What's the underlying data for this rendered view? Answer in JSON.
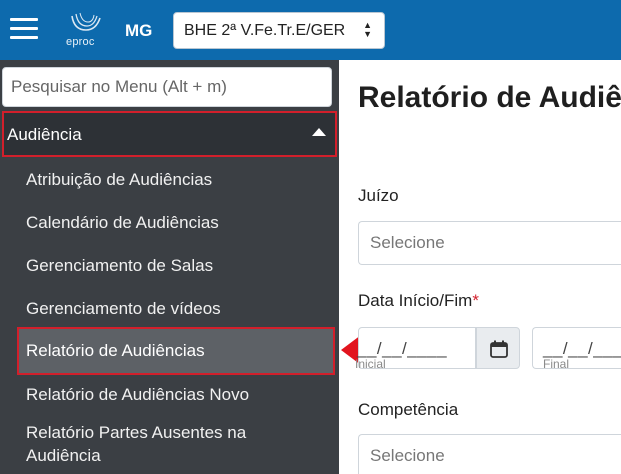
{
  "header": {
    "logo_text": "eproc",
    "state": "MG",
    "unit_select": "BHE 2ª V.Fe.Tr.E/GER"
  },
  "sidebar": {
    "search_placeholder": "Pesquisar no Menu (Alt + m)",
    "section_label": "Audiência",
    "items": [
      "Atribuição de Audiências",
      "Calendário de Audiências",
      "Gerenciamento de Salas",
      "Gerenciamento de vídeos",
      "Relatório de Audiências",
      "Relatório de Audiências Novo",
      "Relatório Partes Ausentes na",
      "Audiência"
    ]
  },
  "main": {
    "title": "Relatório de Audiê",
    "juizo_label": "Juízo",
    "juizo_placeholder": "Selecione",
    "date_label": "Data Início/Fim",
    "date_required": "*",
    "date_start_mask": "__/__/____",
    "date_start_hint": "Inicial",
    "date_end_mask": "__/__/____",
    "date_end_hint": "Final",
    "competencia_label": "Competência",
    "competencia_placeholder": "Selecione"
  },
  "colors": {
    "topbar": "#0d6aad",
    "sidebar": "#3b3f44",
    "highlight_border": "#d21f2b",
    "selected_item": "#5d6166"
  }
}
